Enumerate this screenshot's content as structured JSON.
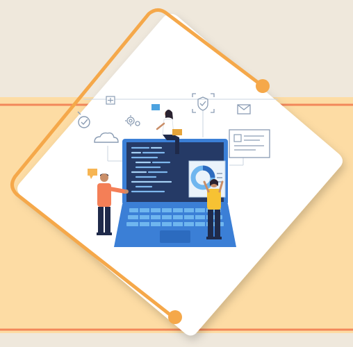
{
  "scene": {
    "colors": {
      "page_background": "#efe8dc",
      "band_fill": "#fddca4",
      "band_line": "#f2875a",
      "frame_orange": "#f5a84a",
      "card_white": "#ffffff",
      "laptop_blue": "#3b7fd6",
      "screen_dark": "#253a66",
      "keyboard_blue": "#6fb6ef",
      "person_orange_shirt": "#f47f57",
      "person_yellow_shirt": "#f7c233",
      "pants_navy": "#1f2a4a",
      "skin": "#c98e68",
      "sketch_line": "#8a9cb3",
      "note_orange": "#f6b553",
      "note_blue": "#4da3e0"
    },
    "icons": [
      "cloud-icon",
      "checkmark-badge-icon",
      "gear-icon",
      "shield-icon",
      "envelope-icon",
      "plus-box-icon",
      "document-card-icon",
      "donut-chart-icon",
      "chat-bubble-icon"
    ]
  }
}
